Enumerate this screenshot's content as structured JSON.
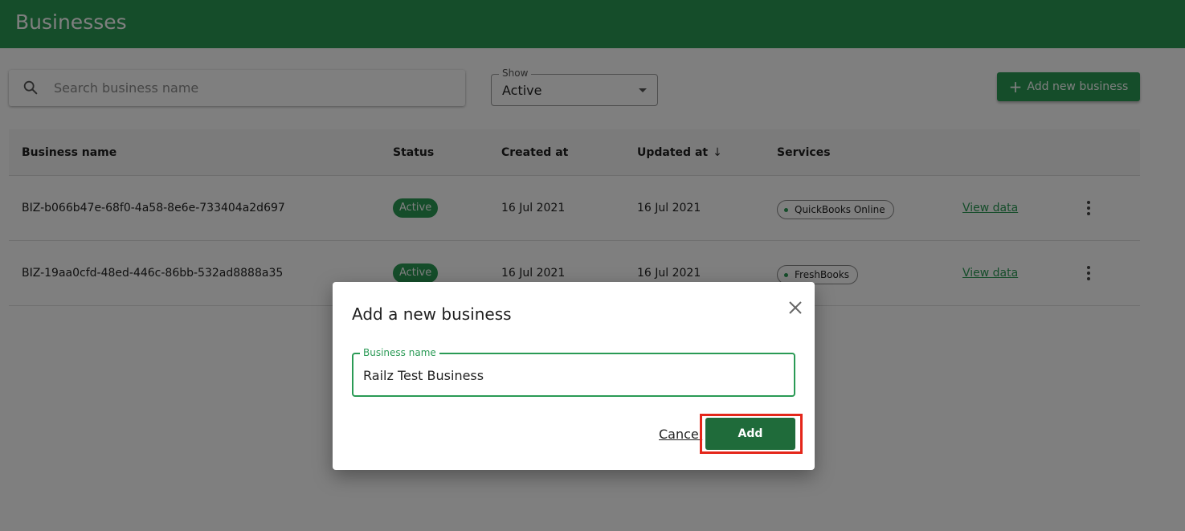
{
  "header": {
    "title": "Businesses"
  },
  "toolbar": {
    "search_placeholder": "Search business name",
    "show_label": "Show",
    "show_value": "Active",
    "add_button_label": "Add new business"
  },
  "table": {
    "columns": [
      "Business name",
      "Status",
      "Created at",
      "Updated at",
      "Services"
    ],
    "sort_indicator": "↓",
    "rows": [
      {
        "name": "BIZ-b066b47e-68f0-4a58-8e6e-733404a2d697",
        "status": "Active",
        "created": "16 Jul 2021",
        "updated": "16 Jul 2021",
        "service": "QuickBooks Online",
        "action": "View data"
      },
      {
        "name": "BIZ-19aa0cfd-48ed-446c-86bb-532ad8888a35",
        "status": "Active",
        "created": "16 Jul 2021",
        "updated": "16 Jul 2021",
        "service": "FreshBooks",
        "action": "View data"
      }
    ]
  },
  "dialog": {
    "title": "Add a new business",
    "field_label": "Business name",
    "field_value": "Railz Test Business",
    "cancel_label": "Cancel",
    "confirm_label": "Add"
  },
  "colors": {
    "brand": "#2a9a55",
    "confirm": "#1f6b3a",
    "highlight": "#e4261a"
  },
  "icons": [
    "search-icon",
    "chevron-down-icon",
    "plus-icon",
    "arrow-down-icon",
    "more-vert-icon",
    "close-icon"
  ]
}
